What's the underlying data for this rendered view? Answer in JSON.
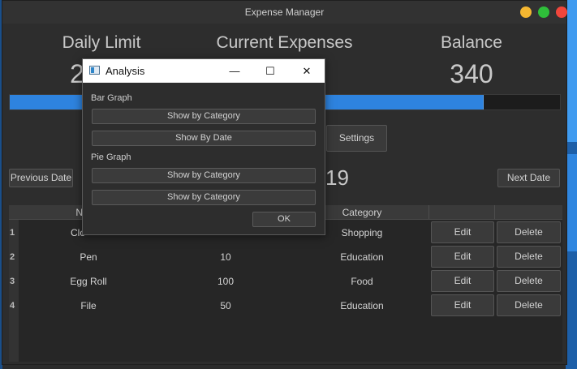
{
  "window": {
    "title": "Expense Manager"
  },
  "stats": {
    "daily_limit_label": "Daily Limit",
    "daily_limit_value": "2",
    "current_expenses_label": "Current Expenses",
    "balance_label": "Balance",
    "balance_value": "340"
  },
  "progress": {
    "fraction": 0.86,
    "color": "#2e83df"
  },
  "buttons": {
    "settings": "Settings",
    "previous_date": "Previous Date",
    "next_date": "Next Date"
  },
  "date_partial": "19",
  "table": {
    "headers": [
      "Na",
      "Category"
    ],
    "rows": [
      {
        "num": "1",
        "name": "Clo",
        "amount": "",
        "category": "Shopping",
        "edit": "Edit",
        "delete": "Delete"
      },
      {
        "num": "2",
        "name": "Pen",
        "amount": "10",
        "category": "Education",
        "edit": "Edit",
        "delete": "Delete"
      },
      {
        "num": "3",
        "name": "Egg Roll",
        "amount": "100",
        "category": "Food",
        "edit": "Edit",
        "delete": "Delete"
      },
      {
        "num": "4",
        "name": "File",
        "amount": "50",
        "category": "Education",
        "edit": "Edit",
        "delete": "Delete"
      }
    ]
  },
  "dialog": {
    "title": "Analysis",
    "bar_graph_label": "Bar Graph",
    "bar_show_category": "Show by Category",
    "bar_show_date": "Show By Date",
    "pie_graph_label": "Pie Graph",
    "pie_show_category_1": "Show by Category",
    "pie_show_category_2": "Show by Category",
    "ok": "OK",
    "minimize_glyph": "—",
    "maximize_glyph": "☐",
    "close_glyph": "✕"
  }
}
